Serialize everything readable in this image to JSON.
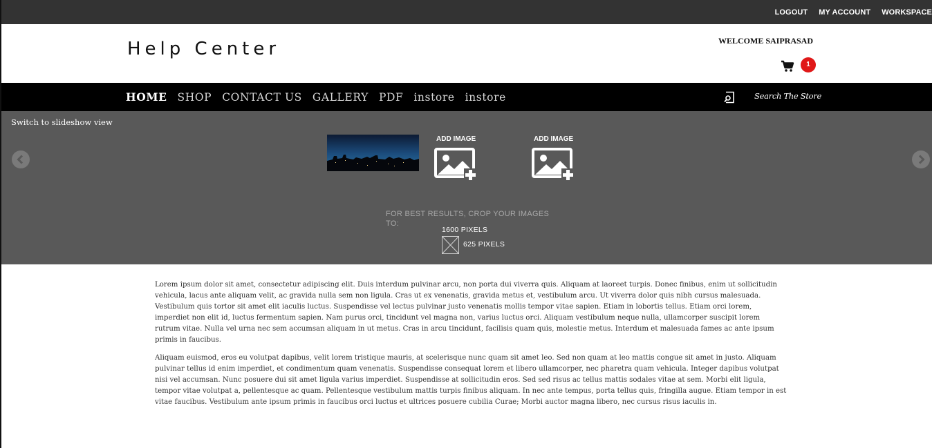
{
  "topbar": {
    "links": [
      "LOGOUT",
      "MY ACCOUNT",
      "WORKSPACE"
    ]
  },
  "header": {
    "brand": "Help Center",
    "welcome": "WELCOME SAIPRASAD",
    "cart": {
      "icon": "cart-icon",
      "count": "1"
    }
  },
  "nav": {
    "items": [
      "HOME",
      "SHOP",
      "CONTACT US",
      "GALLERY",
      "PDF",
      "instore",
      "instore"
    ],
    "active_index": 0,
    "search_placeholder": "Search The Store",
    "search_icon": "search-icon"
  },
  "slideshow": {
    "switch_label": "Switch to slideshow view",
    "prev_icon": "chevron-left-icon",
    "next_icon": "chevron-right-icon",
    "add_image_label": "ADD IMAGE",
    "crop_hint": "FOR BEST RESULTS, CROP YOUR IMAGES TO:",
    "width_hint": "1600 PIXELS",
    "height_hint": "625 PIXELS"
  },
  "content": {
    "paragraphs": [
      "Lorem ipsum dolor sit amet, consectetur adipiscing elit. Duis interdum pulvinar arcu, non porta dui viverra quis. Aliquam at laoreet turpis. Donec finibus, enim ut sollicitudin vehicula, lacus ante aliquam velit, ac gravida nulla sem non ligula. Cras ut ex venenatis, gravida metus et, vestibulum arcu. Ut viverra dolor quis nibh cursus malesuada. Vestibulum quis tortor sit amet elit iaculis luctus. Suspendisse vel lectus pulvinar justo venenatis mollis tempor vitae sapien. Etiam in lobortis tellus. Etiam orci lorem, imperdiet non elit id, luctus fermentum sapien. Nam purus orci, tincidunt vel magna non, varius luctus orci. Aliquam vestibulum neque nulla, ullamcorper suscipit lorem rutrum vitae. Nulla vel urna nec sem accumsan aliquam in ut metus. Cras in arcu tincidunt, facilisis quam quis, molestie metus. Interdum et malesuada fames ac ante ipsum primis in faucibus.",
      "Aliquam euismod, eros eu volutpat dapibus, velit lorem tristique mauris, at scelerisque nunc quam sit amet leo. Sed non quam at leo mattis congue sit amet in justo. Aliquam pulvinar tellus id enim imperdiet, et condimentum quam venenatis. Suspendisse consequat lorem et libero ullamcorper, nec pharetra quam vehicula. Integer dapibus volutpat nisi vel accumsan. Nunc posuere dui sit amet ligula varius imperdiet. Suspendisse at sollicitudin eros. Sed sed risus ac tellus mattis sodales vitae at sem. Morbi elit ligula, tempor vitae volutpat a, pellentesque ac quam. Pellentesque vestibulum mattis turpis finibus aliquam. In nec ante tempus, porta tellus quis, fringilla augue. Etiam tempor in est vitae faucibus. Vestibulum ante ipsum primis in faucibus orci luctus et ultrices posuere cubilia Curae; Morbi auctor magna libero, nec cursus risus iaculis in."
    ]
  },
  "colors": {
    "topbar": "#333333",
    "nav": "#000000",
    "slideshow": "#595959",
    "badge": "#e01818"
  }
}
